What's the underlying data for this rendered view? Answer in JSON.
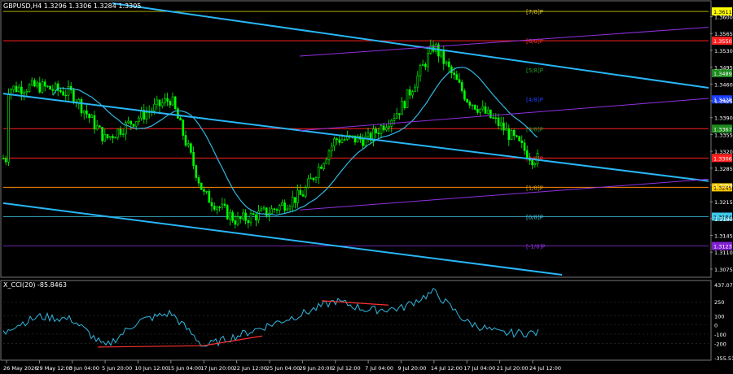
{
  "main_panel": {
    "title": "GBPUSD,H4  1.3296 1.3306 1.3284 1.3305",
    "price_axis": [
      "1.3600",
      "1.3565",
      "1.3530",
      "1.3495",
      "1.3460",
      "1.3425",
      "1.3390",
      "1.3355",
      "1.3320",
      "1.3285",
      "1.3250",
      "1.3215",
      "1.3180",
      "1.3145",
      "1.3110",
      "1.3075"
    ],
    "tags": [
      {
        "text": "1.3611",
        "price": 1.3611,
        "bg": "#ffff00",
        "fg": "#000000"
      },
      {
        "text": "1.3550",
        "price": 1.355,
        "bg": "#ff2020",
        "fg": "#ffffff"
      },
      {
        "text": "1.3489",
        "price": 1.34825,
        "bg": "#1e8a1e",
        "fg": "#ffffff"
      },
      {
        "text": "1.3428",
        "price": 1.3428,
        "bg": "#1a3dff",
        "fg": "#ffffff"
      },
      {
        "text": "1.3367",
        "price": 1.3367,
        "bg": "#1e8a1e",
        "fg": "#ffffff"
      },
      {
        "text": "1.3306",
        "price": 1.3306,
        "bg": "#ff2020",
        "fg": "#ffffff"
      },
      {
        "text": "1.3245",
        "price": 1.3245,
        "bg": "#ffcc00",
        "fg": "#000000"
      },
      {
        "text": "1.3184",
        "price": 1.3184,
        "bg": "#40c8e8",
        "fg": "#000000"
      },
      {
        "text": "1.3123",
        "price": 1.3123,
        "bg": "#8020d0",
        "fg": "#ffffff"
      }
    ],
    "murrey_labels": [
      {
        "text": "[7/8]P",
        "price": 1.3611,
        "color": "#e0c020"
      },
      {
        "text": "[6/8]P",
        "price": 1.355,
        "color": "#ff3030"
      },
      {
        "text": "[5/8]P",
        "price": 1.3489,
        "color": "#20a020"
      },
      {
        "text": "[4/8]P",
        "price": 1.3428,
        "color": "#2040ff"
      },
      {
        "text": "[3/8]P",
        "price": 1.3367,
        "color": "#20a020"
      },
      {
        "text": "[2/8]P",
        "price": 1.3306,
        "color": "#ff3030"
      },
      {
        "text": "[1/8]P",
        "price": 1.3245,
        "color": "#e0a000"
      },
      {
        "text": "[0/8]P",
        "price": 1.3184,
        "color": "#40c8e8"
      },
      {
        "text": "[-1/8]P",
        "price": 1.3123,
        "color": "#9030e0"
      }
    ]
  },
  "indicator": {
    "title": "X_CCI(20) -85.8463",
    "axis": [
      "437.0745",
      "250",
      "100",
      "0",
      "-100",
      "-200",
      "-355.5134"
    ],
    "top_value": "437.0745",
    "bottom_value": "-355.5134"
  },
  "time_axis": [
    "26 May 2026",
    "29 May 12:00",
    "3 Jun 04:00",
    "5 Jun 20:00",
    "10 Jun 12:00",
    "15 Jun 04:00",
    "17 Jun 20:00",
    "22 Jun 12:00",
    "25 Jun 04:00",
    "29 Jun 20:00",
    "2 Jul 12:00",
    "7 Jul 04:00",
    "9 Jul 20:00",
    "14 Jul 12:00",
    "17 Jul 04:00",
    "21 Jul 20:00",
    "24 Jul 12:00"
  ],
  "colors": {
    "candle": "#00ff00",
    "moving_average": "#30b8e0",
    "channel": "#29b6f6",
    "murrey_purple": "#9030e0",
    "cci_line": "#30b8e0",
    "divergence": "#ff3030"
  },
  "chart_data": {
    "type": "candlestick",
    "symbol": "GBPUSD",
    "timeframe": "H4",
    "ohlc_last": {
      "open": 1.3296,
      "high": 1.3306,
      "low": 1.3284,
      "close": 1.3305
    },
    "ylim": [
      1.3063,
      1.3628
    ],
    "approx_close_path": [
      {
        "x": "26 May 2026",
        "y": 1.345
      },
      {
        "x": "29 May 12:00",
        "y": 1.3455
      },
      {
        "x": "3 Jun 04:00",
        "y": 1.344
      },
      {
        "x": "5 Jun 20:00",
        "y": 1.3345
      },
      {
        "x": "10 Jun 12:00",
        "y": 1.339
      },
      {
        "x": "15 Jun 04:00",
        "y": 1.343
      },
      {
        "x": "17 Jun 20:00",
        "y": 1.323
      },
      {
        "x": "22 Jun 12:00",
        "y": 1.3175
      },
      {
        "x": "25 Jun 04:00",
        "y": 1.3195
      },
      {
        "x": "29 Jun 20:00",
        "y": 1.323
      },
      {
        "x": "2 Jul 12:00",
        "y": 1.3345
      },
      {
        "x": "7 Jul 04:00",
        "y": 1.3345
      },
      {
        "x": "9 Jul 20:00",
        "y": 1.341
      },
      {
        "x": "14 Jul 12:00",
        "y": 1.354
      },
      {
        "x": "17 Jul 04:00",
        "y": 1.343
      },
      {
        "x": "21 Jul 20:00",
        "y": 1.3375
      },
      {
        "x": "24 Jul 12:00",
        "y": 1.3305
      }
    ],
    "cci_path": [
      {
        "x": "26 May 2026",
        "y": -40
      },
      {
        "x": "29 May 12:00",
        "y": 90
      },
      {
        "x": "3 Jun 04:00",
        "y": 60
      },
      {
        "x": "5 Jun 20:00",
        "y": -240
      },
      {
        "x": "10 Jun 12:00",
        "y": 40
      },
      {
        "x": "15 Jun 04:00",
        "y": 130
      },
      {
        "x": "17 Jun 20:00",
        "y": -230
      },
      {
        "x": "22 Jun 12:00",
        "y": -120
      },
      {
        "x": "25 Jun 04:00",
        "y": 0
      },
      {
        "x": "29 Jun 20:00",
        "y": 120
      },
      {
        "x": "2 Jul 12:00",
        "y": 260
      },
      {
        "x": "7 Jul 04:00",
        "y": 160
      },
      {
        "x": "9 Jul 20:00",
        "y": 180
      },
      {
        "x": "14 Jul 12:00",
        "y": 360
      },
      {
        "x": "17 Jul 04:00",
        "y": 30
      },
      {
        "x": "21 Jul 20:00",
        "y": -90
      },
      {
        "x": "24 Jul 12:00",
        "y": -86
      }
    ]
  }
}
